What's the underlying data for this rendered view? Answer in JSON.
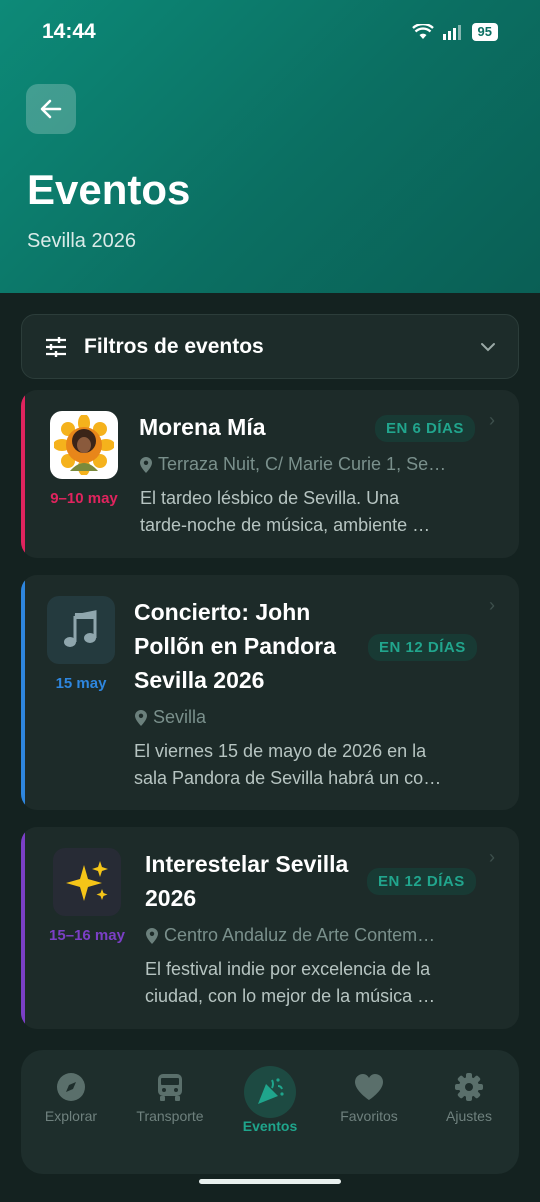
{
  "status_bar": {
    "time": "14:44",
    "battery": "95"
  },
  "header": {
    "title": "Eventos",
    "subtitle": "Sevilla 2026"
  },
  "filters": {
    "label": "Filtros de eventos"
  },
  "events": [
    {
      "title": "Morena Mía",
      "badge": "EN 6 DÍAS",
      "date": "9–10 may",
      "location": "Terraza Nuit, C/ Marie Curie 1, Se…",
      "description_line1": "El tardeo lésbico de Sevilla. Una",
      "description_line2": "tarde-noche de música, ambiente …",
      "accent": "#e0245e",
      "icon": "sunflower-portrait-image"
    },
    {
      "title_line1": "Concierto: John",
      "title_line2": "Pollõn en Pandora",
      "title_line3": "Sevilla 2026",
      "badge": "EN 12 DÍAS",
      "date": "15 may",
      "location": "Sevilla",
      "description_line1": "El viernes 15 de mayo de 2026 en la",
      "description_line2": "sala Pandora de Sevilla habrá un co…",
      "accent": "#2e86de",
      "icon": "music-note-icon"
    },
    {
      "title_line1": "Interestelar Sevilla",
      "title_line2": "2026",
      "badge": "EN 12 DÍAS",
      "date": "15–16 may",
      "location": "Centro Andaluz de Arte Contem…",
      "description_line1": "El festival indie por excelencia de la",
      "description_line2": "ciudad, con lo mejor de la música …",
      "accent": "#7b3fc6",
      "icon": "sparkles-icon"
    }
  ],
  "nav": {
    "items": [
      {
        "label": "Explorar",
        "icon": "compass-icon"
      },
      {
        "label": "Transporte",
        "icon": "bus-icon"
      },
      {
        "label": "Eventos",
        "icon": "party-popper-icon",
        "active": true
      },
      {
        "label": "Favoritos",
        "icon": "heart-icon"
      },
      {
        "label": "Ajustes",
        "icon": "gear-icon"
      }
    ]
  },
  "colors": {
    "accent": "#0d8a78",
    "active_nav": "#1fa58c"
  }
}
